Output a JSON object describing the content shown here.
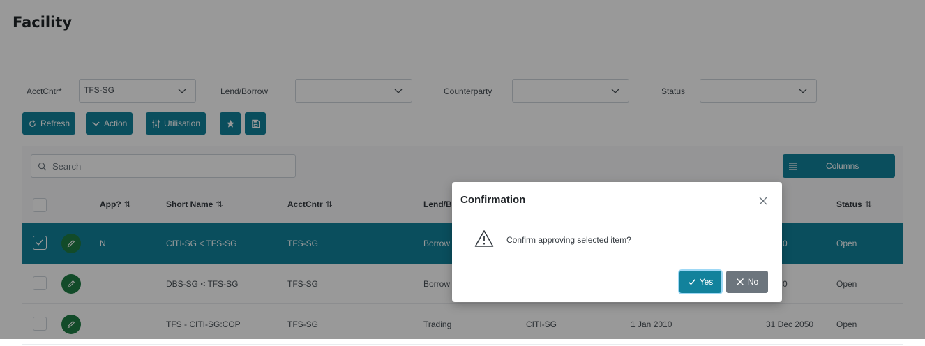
{
  "page": {
    "title": "Facility"
  },
  "filters": {
    "acctcntr_label": "AcctCntr*",
    "acctcntr_value": "TFS-SG",
    "lendborrow_label": "Lend/Borrow",
    "lendborrow_value": "",
    "counterparty_label": "Counterparty",
    "counterparty_value": "",
    "status_label": "Status",
    "status_value": ""
  },
  "toolbar": {
    "refresh": "Refresh",
    "action": "Action",
    "utilisation": "Utilisation"
  },
  "table": {
    "search_placeholder": "Search",
    "columns_button": "Columns",
    "headers": {
      "app": "App?",
      "short_name": "Short Name",
      "acctcntr": "AcctCntr",
      "lendborrow": "Lend/B",
      "status": "Status",
      "sort_icon": "⇅"
    },
    "rows": [
      {
        "app": "N",
        "short_name": "CITI-SG < TFS-SG",
        "acctcntr": "TFS-SG",
        "lendborrow": "Borrow",
        "counterparty": "",
        "start": "",
        "end": "0",
        "status": "Open",
        "selected": true
      },
      {
        "app": "",
        "short_name": "DBS-SG < TFS-SG",
        "acctcntr": "TFS-SG",
        "lendborrow": "Borrow",
        "counterparty": "",
        "start": "",
        "end": "0",
        "status": "Open",
        "selected": false
      },
      {
        "app": "",
        "short_name": "TFS - CITI-SG:COP",
        "acctcntr": "TFS-SG",
        "lendborrow": "Trading",
        "counterparty": "CITI-SG",
        "start": "1 Jan 2010",
        "end": "31 Dec 2050",
        "status": "Open",
        "selected": false
      }
    ]
  },
  "dialog": {
    "title": "Confirmation",
    "message": "Confirm approving selected item?",
    "yes": "Yes",
    "no": "No"
  },
  "colors": {
    "primary": "#12829c",
    "edit_green": "#1f7e45",
    "secondary": "#6c757d"
  },
  "icons": [
    "refresh-icon",
    "chevron-down-icon",
    "utilisation-icon",
    "star-icon",
    "save-icon",
    "search-icon",
    "columns-icon",
    "pencil-icon",
    "close-icon",
    "warning-icon",
    "check-icon",
    "x-icon"
  ]
}
